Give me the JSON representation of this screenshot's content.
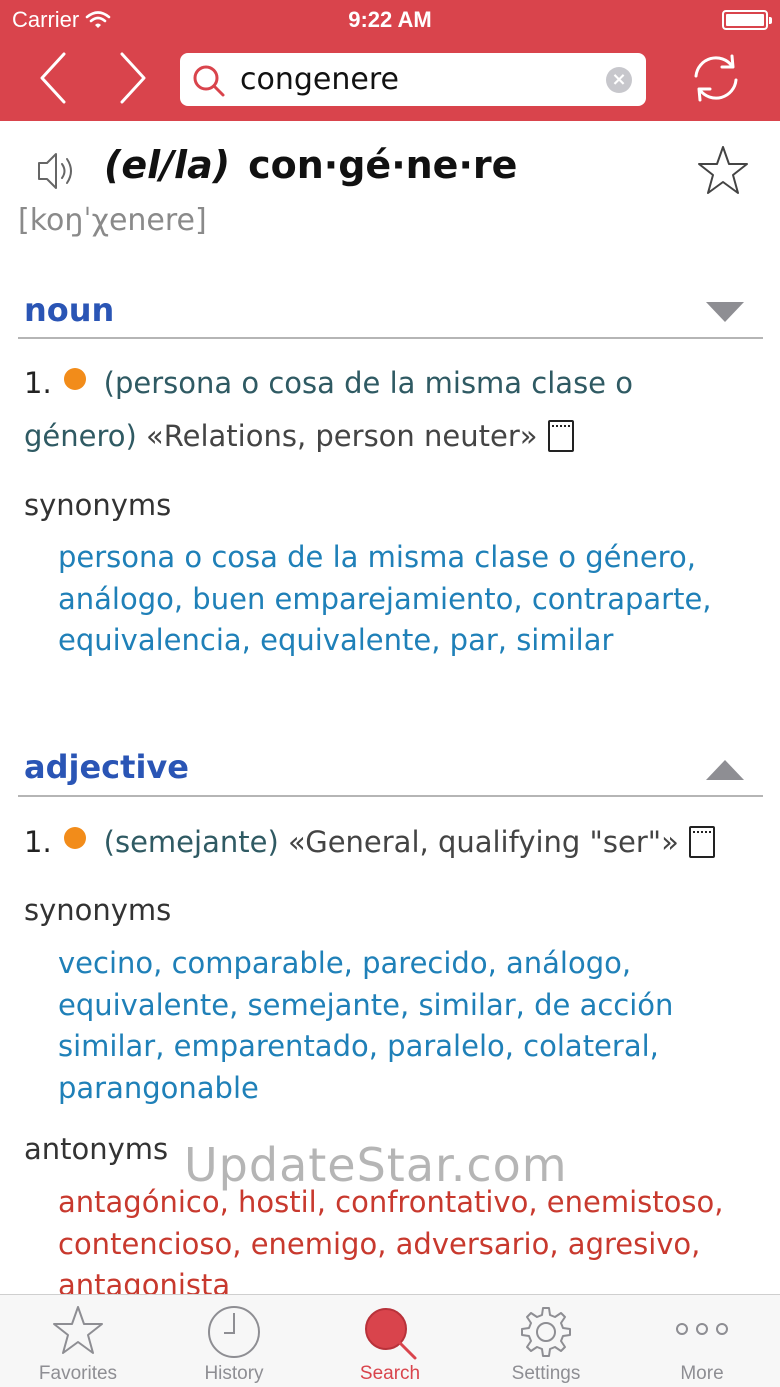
{
  "status_bar": {
    "carrier": "Carrier",
    "time": "9:22 AM"
  },
  "search": {
    "query": "congenere"
  },
  "entry": {
    "gender": "(el/la)",
    "headword": "con·gé·ne·re",
    "pronunciation": "[koŋˈχenere]"
  },
  "sections": [
    {
      "pos": "noun",
      "toggle": "collapse",
      "sense_number": "1.",
      "definition_part1": "(persona o cosa de la misma clase o",
      "definition_part2": "género)",
      "example": "«Relations, person neuter»",
      "synonyms_label": "synonyms",
      "synonyms": "persona o cosa de la misma clase o género, análogo, buen emparejamiento, contraparte, equivalencia, equivalente, par, similar"
    },
    {
      "pos": "adjective",
      "toggle": "expand",
      "sense_number": "1.",
      "definition": "(semejante)",
      "example": "«General, qualifying \"ser\"»",
      "synonyms_label": "synonyms",
      "synonyms": "vecino, comparable, parecido, análogo, equivalente, semejante, similar, de acción similar, emparentado, paralelo, colateral, parangonable",
      "antonyms_label": "antonyms",
      "antonyms": "antagónico, hostil, confrontativo, enemistoso, contencioso, enemigo, adversario, agresivo, antagonista"
    }
  ],
  "watermark": "UpdateStar.com",
  "tabs": [
    {
      "label": "Favorites",
      "icon": "star-icon"
    },
    {
      "label": "History",
      "icon": "clock-icon"
    },
    {
      "label": "Search",
      "icon": "search-icon",
      "active": true
    },
    {
      "label": "Settings",
      "icon": "gear-icon"
    },
    {
      "label": "More",
      "icon": "more-icon"
    }
  ],
  "colors": {
    "header": "#d9444c",
    "pos": "#2a55b5",
    "synonym": "#1f80b8",
    "antonym": "#c8392e",
    "bullet": "#f28c1a"
  }
}
